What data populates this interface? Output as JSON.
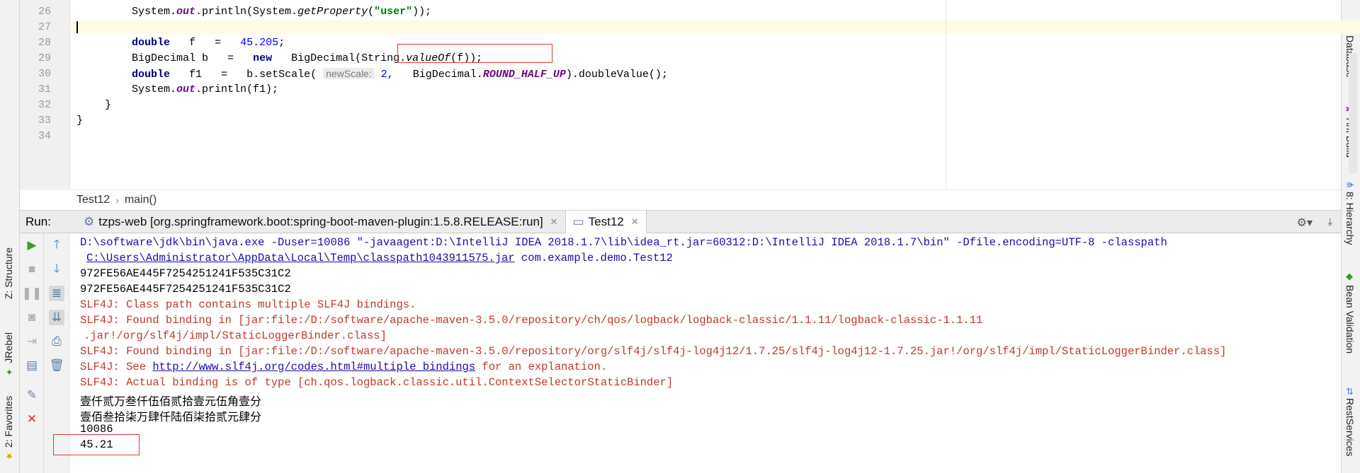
{
  "editor": {
    "line_numbers": [
      "26",
      "27",
      "28",
      "29",
      "30",
      "31",
      "32",
      "33",
      "34"
    ],
    "lines": {
      "l26": {
        "a": "System.",
        "b": "out",
        "c": ".println(System.",
        "d": "getProperty",
        "e": "(",
        "f": "\"user\"",
        "g": "));"
      },
      "l28": {
        "kw": "double",
        "var": "f",
        "eq": "=",
        "num": "45.205",
        "end": ";"
      },
      "l29": {
        "type": "BigDecimal b",
        "eq": "=",
        "kw": "new",
        "rest_a": "BigDecimal(String.",
        "rest_b": "valueOf",
        "rest_c": "(f));"
      },
      "l30": {
        "kw": "double",
        "var": "f1",
        "eq": "=",
        "call": "b.setScale(",
        "hint": "newScale:",
        "num": "2,",
        "cls": "BigDecimal.",
        "const": "ROUND_HALF_UP",
        "end": ").doubleValue();"
      },
      "l31": {
        "a": "System.",
        "b": "out",
        "c": ".println(f1);"
      },
      "l32": "}",
      "l33": "}"
    }
  },
  "breadcrumb": {
    "class": "Test12",
    "separator": "›",
    "method": "main()"
  },
  "run": {
    "label": "Run:",
    "tabs": [
      {
        "label": "tzps-web [org.springframework.boot:spring-boot-maven-plugin:1.5.8.RELEASE:run]",
        "icon": "gear-icon"
      },
      {
        "label": "Test12",
        "icon": "window-icon"
      }
    ]
  },
  "console": {
    "l1": "D:\\software\\jdk\\bin\\java.exe -Duser=10086 \"-javaagent:D:\\IntelliJ IDEA 2018.1.7\\lib\\idea_rt.jar=60312:D:\\IntelliJ IDEA 2018.1.7\\bin\" -Dfile.encoding=UTF-8 -classpath",
    "l2_link": "C:\\Users\\Administrator\\AppData\\Local\\Temp\\classpath1043911575.jar",
    "l2_rest": " com.example.demo.Test12",
    "l3": "972FE56AE445F7254251241F535C31C2",
    "l4": "972FE56AE445F7254251241F535C31C2",
    "l5": "SLF4J: Class path contains multiple SLF4J bindings.",
    "l6": "SLF4J: Found binding in [jar:file:/D:/software/apache-maven-3.5.0/repository/ch/qos/logback/logback-classic/1.1.11/logback-classic-1.1.11",
    "l7": ".jar!/org/slf4j/impl/StaticLoggerBinder.class]",
    "l8": "SLF4J: Found binding in [jar:file:/D:/software/apache-maven-3.5.0/repository/org/slf4j/slf4j-log4j12/1.7.25/slf4j-log4j12-1.7.25.jar!/org/slf4j/impl/StaticLoggerBinder.class]",
    "l9_a": "SLF4J: See ",
    "l9_link": "http://www.slf4j.org/codes.html#multiple_bindings",
    "l9_b": " for an explanation.",
    "l10": "SLF4J: Actual binding is of type [ch.qos.logback.classic.util.ContextSelectorStaticBinder]",
    "l11": "壹仟贰万叁仟伍佰贰拾壹元伍角壹分",
    "l12": "壹佰叁拾柒万肆仟陆佰柒拾贰元肆分",
    "l13": "10086",
    "l14": "45.21"
  },
  "left_tool_windows": [
    "Z: Structure",
    "JRebel",
    "2: Favorites"
  ],
  "right_tool_windows": [
    "Database",
    "Ant Build",
    "8: Hierarchy",
    "Bean Validation",
    "RestServices"
  ],
  "colors": {
    "keyword": "#000080",
    "number": "#0000ff",
    "string": "#008000",
    "error": "#c0392b",
    "link": "#1a0dab",
    "highlight_box": "#e53935"
  }
}
